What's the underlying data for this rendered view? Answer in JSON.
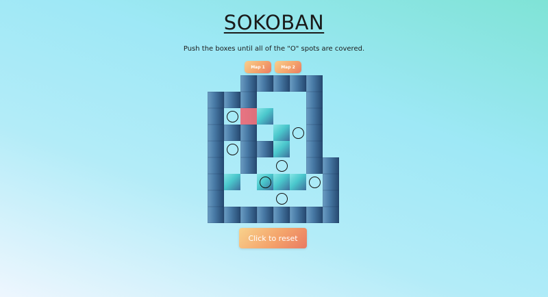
{
  "header": {
    "title": "SOKOBAN",
    "instructions": "Push the boxes until all of the \"O\" spots are covered."
  },
  "map_buttons": [
    {
      "label": "Map 1"
    },
    {
      "label": "Map 2"
    }
  ],
  "reset_button": {
    "label": "Click to reset"
  },
  "board": {
    "columns": 8,
    "rows": 9,
    "legend": {
      "#": "wall",
      " ": "floor",
      "$": "box",
      "@": "player",
      ".": "goal",
      "*": "box on goal",
      "-": "outside"
    },
    "grid": [
      "--#####-",
      "###   #-",
      "#.@$  #-",
      "### $.#-",
      "#.##$ #-",
      "# # . ##",
      "#$ *$$.#",
      "#   .  #",
      "########"
    ],
    "colors": {
      "wall": "#4677a3",
      "box": "#4ac7cc",
      "player": "#e0717e",
      "goal": "#111111"
    }
  }
}
